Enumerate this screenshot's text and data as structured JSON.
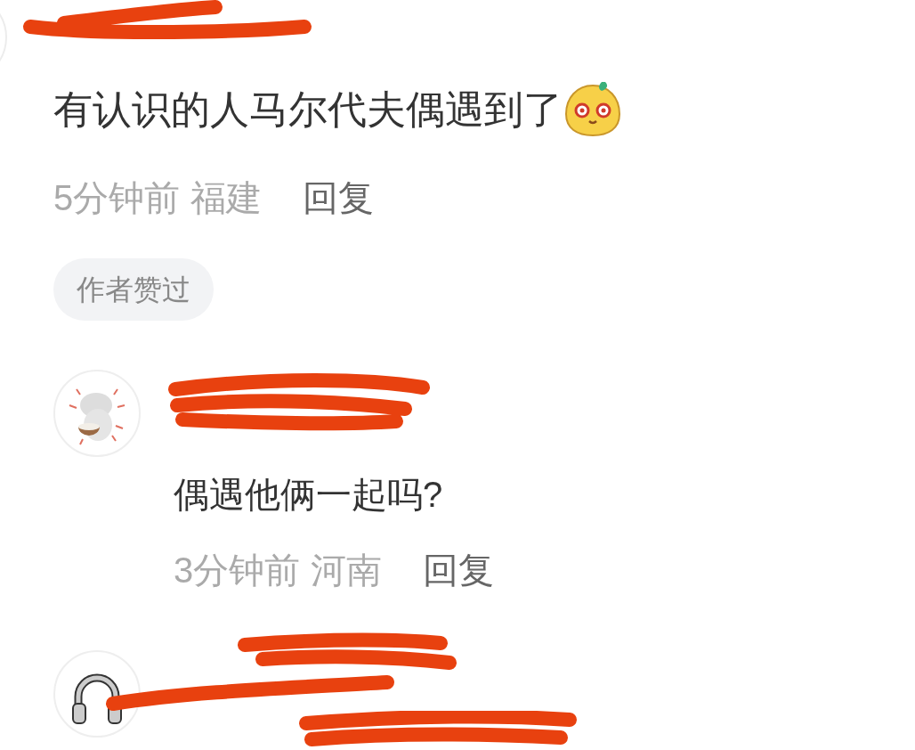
{
  "comment": {
    "text": "有认识的人马尔代夫偶遇到了",
    "time": "5分钟前",
    "location": "福建",
    "reply": "回复",
    "badge": "作者赞过"
  },
  "replies": [
    {
      "kind": "dog",
      "text": "偶遇他俩一起吗?",
      "time": "3分钟前",
      "location": "河南",
      "reply": "回复"
    },
    {
      "kind": "headphones"
    }
  ]
}
